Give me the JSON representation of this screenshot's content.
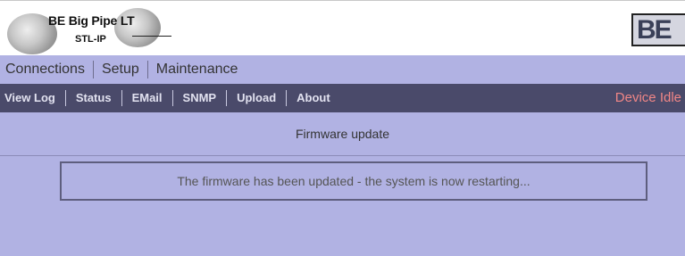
{
  "logo": {
    "title": "BE Big Pipe LT",
    "subtitle": "STL-IP",
    "brand_text": "BE"
  },
  "nav_primary": [
    {
      "label": "Connections"
    },
    {
      "label": "Setup"
    },
    {
      "label": "Maintenance"
    }
  ],
  "nav_secondary": [
    {
      "label": "View Log"
    },
    {
      "label": "Status"
    },
    {
      "label": "EMail"
    },
    {
      "label": "SNMP"
    },
    {
      "label": "Upload"
    },
    {
      "label": "About"
    }
  ],
  "device_status": "Device Idle",
  "main": {
    "title": "Firmware update",
    "message": "The firmware has been updated - the system is now restarting..."
  },
  "colors": {
    "panel_bg": "#b1b2e3",
    "nav_bar_bg": "#4a4a6a",
    "status_color": "#f08686"
  }
}
